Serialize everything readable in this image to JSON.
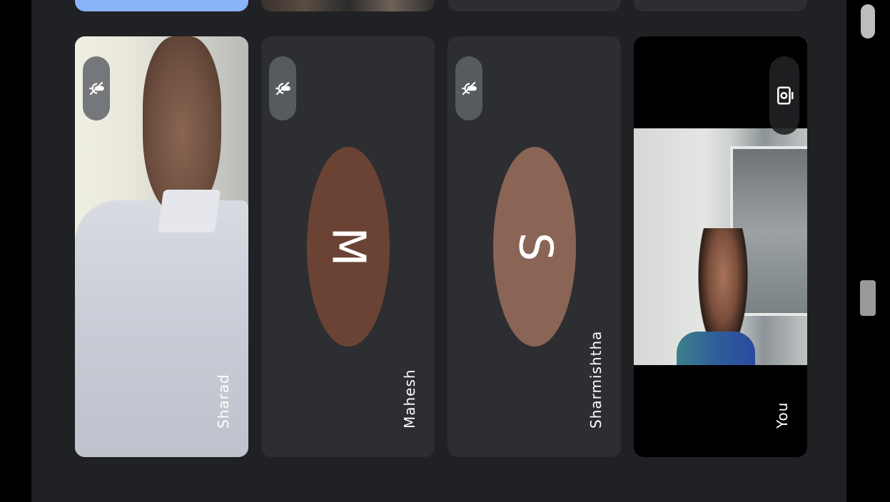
{
  "participants": [
    {
      "name": "Sharad",
      "muted": true,
      "video": true
    },
    {
      "name": "Mahesh",
      "muted": true,
      "video": false,
      "avatar_letter": "M",
      "avatar_color": "#6b4335"
    },
    {
      "name": "Sharmishtha",
      "muted": true,
      "video": false,
      "avatar_letter": "S",
      "avatar_color": "#8a6556"
    },
    {
      "name": "You",
      "muted": false,
      "video": true,
      "self_view": true
    }
  ],
  "icons": {
    "mute": "mic-off-icon",
    "camera_switch": "flip-camera-icon"
  },
  "colors": {
    "background": "#202124",
    "tile": "#2d2e31",
    "highlight": "#8ab4f8"
  }
}
